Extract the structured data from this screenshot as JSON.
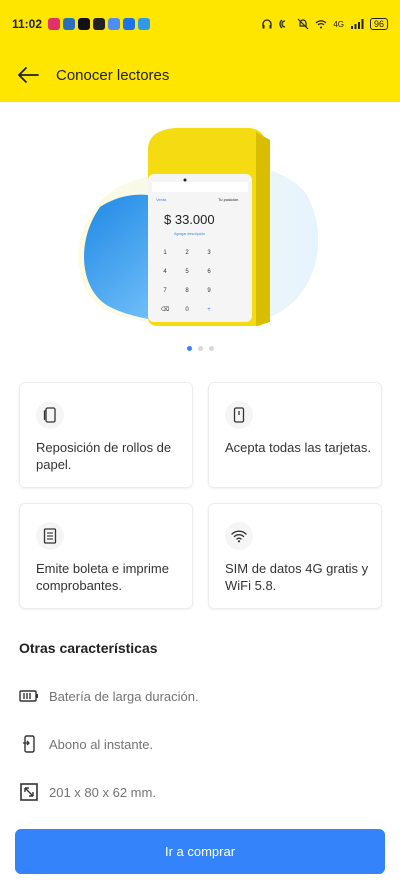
{
  "status_bar": {
    "time": "11:02",
    "battery": "96",
    "network": "4G"
  },
  "header": {
    "title": "Conocer lectores",
    "back_icon": "arrow-left-icon"
  },
  "hero": {
    "screen_amount": "$ 33.000",
    "screen_tab_left": "Venta",
    "screen_tab_right": "Tu posición",
    "screen_link": "Agregar descripción",
    "keypad": [
      "1",
      "2",
      "3",
      "4",
      "5",
      "6",
      "7",
      "8",
      "9",
      "⌫",
      "0",
      "+"
    ],
    "carousel_total": 3,
    "carousel_active": 0
  },
  "cards": [
    {
      "icon": "paper-roll-icon",
      "text": "Reposición de rollos de papel."
    },
    {
      "icon": "card-icon",
      "text": "Acepta todas las tarjetas."
    },
    {
      "icon": "receipt-icon",
      "text": "Emite boleta e imprime comprobantes."
    },
    {
      "icon": "wifi-icon",
      "text": "SIM de datos 4G gratis y WiFi 5.8."
    }
  ],
  "other": {
    "title": "Otras características",
    "items": [
      {
        "icon": "battery-icon",
        "text": "Batería de larga duración."
      },
      {
        "icon": "phone-payment-icon",
        "text": "Abono al instante."
      },
      {
        "icon": "dimensions-icon",
        "text": "201 x 80 x 62 mm."
      }
    ]
  },
  "cta": {
    "label": "Ir a comprar"
  },
  "colors": {
    "header": "#ffe600",
    "accent": "#3483fa"
  }
}
